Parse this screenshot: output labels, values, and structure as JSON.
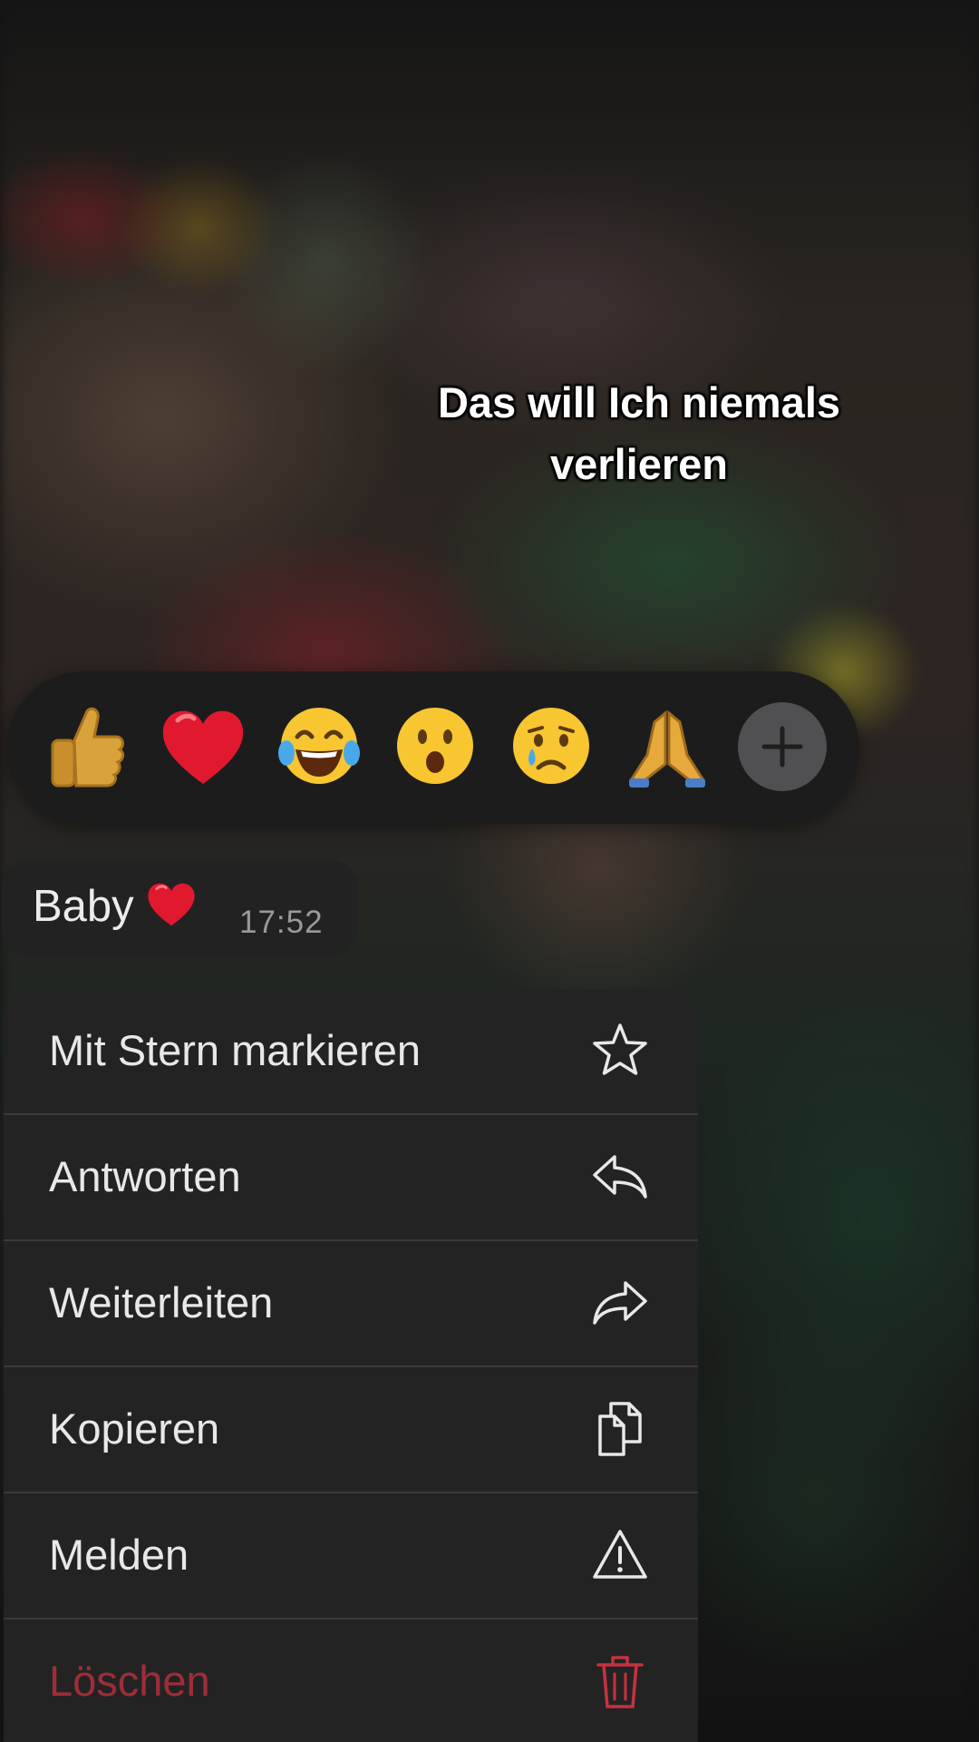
{
  "caption": {
    "line1": "Das will Ich niemals",
    "line2": "verlieren"
  },
  "reactions": {
    "items": [
      {
        "name": "thumbs-up",
        "glyph": "👍"
      },
      {
        "name": "red-heart",
        "glyph": "❤️"
      },
      {
        "name": "tears-of-joy",
        "glyph": "😂"
      },
      {
        "name": "surprised",
        "glyph": "😮"
      },
      {
        "name": "crying",
        "glyph": "😢"
      },
      {
        "name": "folded-hands",
        "glyph": "🙏"
      }
    ],
    "more_icon": "plus-icon"
  },
  "message": {
    "text": "Baby",
    "emoji": "❤️",
    "time": "17:52"
  },
  "menu": {
    "items": [
      {
        "label": "Mit Stern markieren",
        "icon": "star-icon"
      },
      {
        "label": "Antworten",
        "icon": "reply-icon"
      },
      {
        "label": "Weiterleiten",
        "icon": "forward-icon"
      },
      {
        "label": "Kopieren",
        "icon": "copy-icon"
      },
      {
        "label": "Melden",
        "icon": "warning-icon"
      },
      {
        "label": "Löschen",
        "icon": "trash-icon",
        "color": "#c8313e"
      }
    ]
  },
  "colors": {
    "menu_background": "#232324",
    "reaction_bar_background": "#1c1c1d",
    "danger": "#c8313e"
  }
}
